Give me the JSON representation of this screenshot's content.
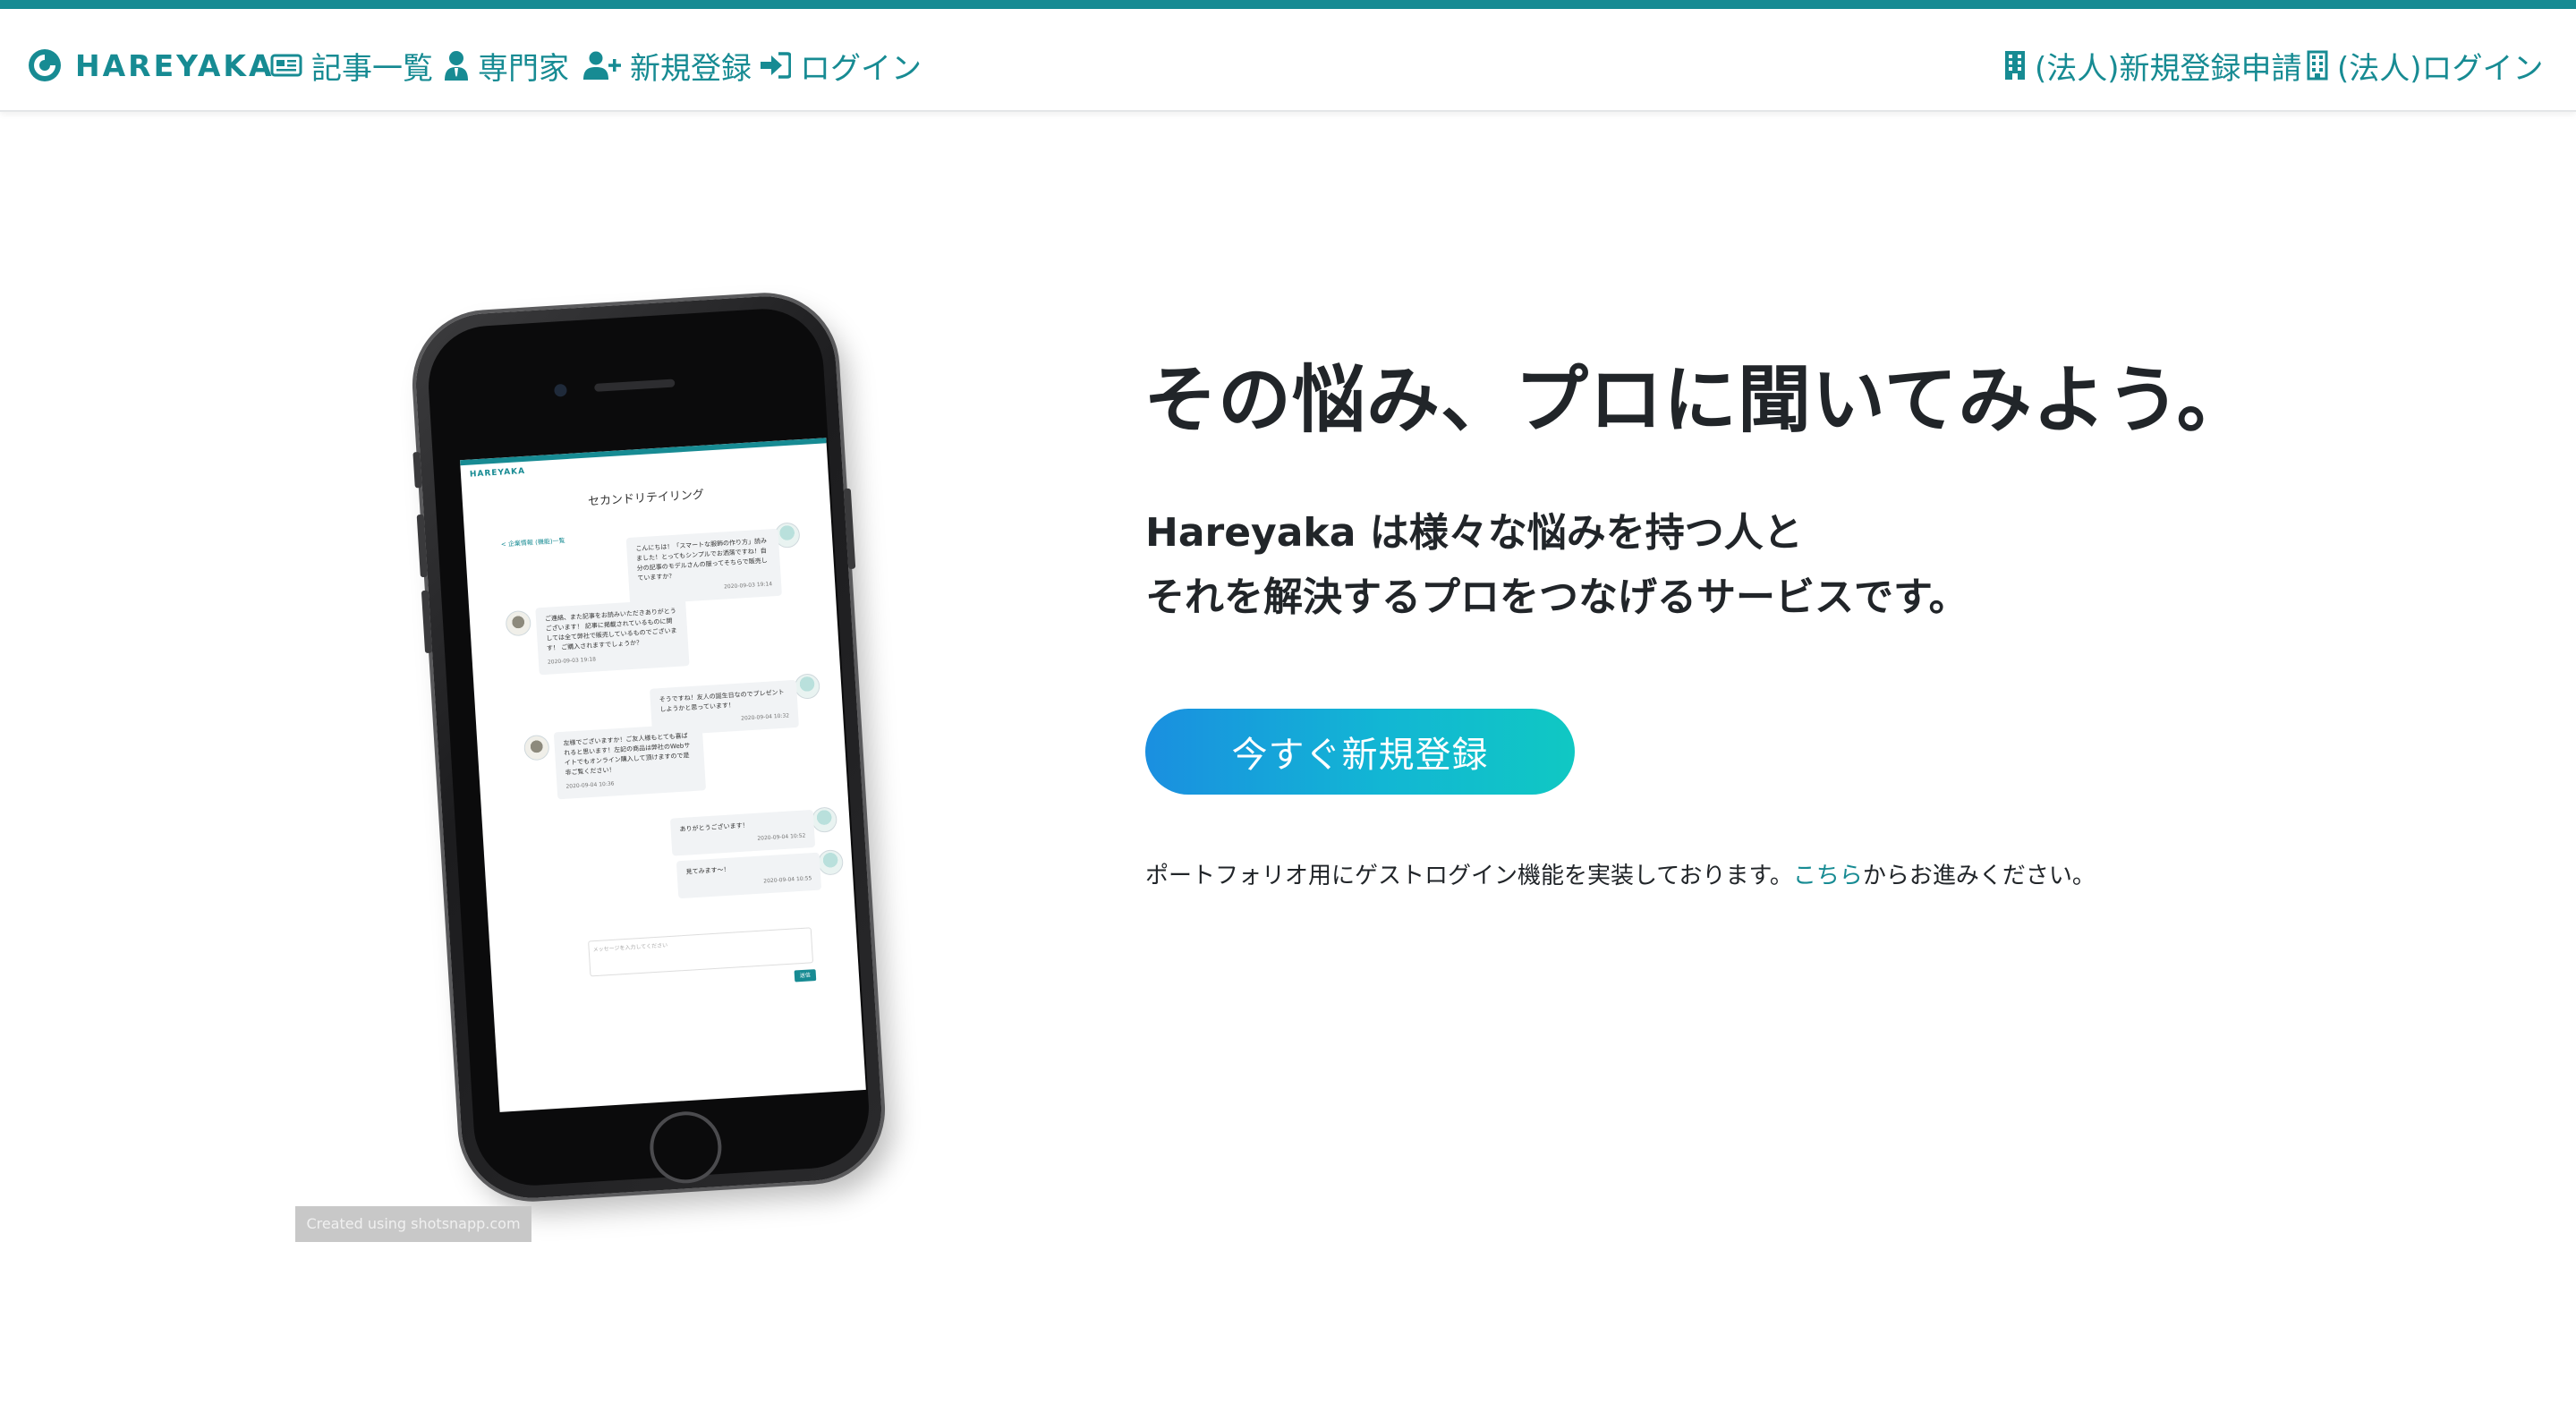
{
  "colors": {
    "brand": "#178b93",
    "cta_start": "#1a8fe0",
    "cta_end": "#10c8c3",
    "text": "#212529"
  },
  "nav": {
    "brand": "HAREYAKA",
    "articles": "記事一覧",
    "experts": "専門家",
    "signup": "新規登録",
    "login": "ログイン",
    "corp_signup": "(法人)新規登録申請",
    "corp_login": "(法人)ログイン",
    "icons": [
      "logo-icon",
      "newspaper-icon",
      "user-tie-icon",
      "user-plus-icon",
      "sign-in-icon",
      "building-icon",
      "building-icon"
    ]
  },
  "hero": {
    "headline": "その悩み、プロに聞いてみよう。",
    "lead_line1": "Hareyaka は様々な悩みを持つ人と",
    "lead_line2": "それを解決するプロをつなげるサービスです。",
    "cta": "今すぐ新規登録",
    "note_before": "ポートフォリオ用にゲストログイン機能を実装しております。",
    "note_link": "こちら",
    "note_after": "からお進みください。"
  },
  "mockup": {
    "brand": "HAREYAKA",
    "title": "セカンドリテイリング",
    "back_link": "< 企業情報 (機能)一覧",
    "messages": [
      {
        "side": "right",
        "text": "こんにちは！「スマートな服飾の作り方」読みました！とってもシンプルでお洒落ですね！自分の記事のモデルさんの服ってそちらで販売していますか？",
        "time": "2020-09-03 19:14"
      },
      {
        "side": "left",
        "text": "ご連絡、また記事をお読みいただきありがとうございます！ 記事に掲載されているものに関しては全て弊社で販売しているものでございます！ ご購入されますでしょうか？",
        "time": "2020-09-03 19:18"
      },
      {
        "side": "right",
        "text": "そうですね！友人の誕生日なのでプレゼントしようかと思っています！",
        "time": "2020-09-04 10:32"
      },
      {
        "side": "left",
        "text": "左様でございますか！ご友人様もとても喜ばれると思います！左記の商品は弊社のWebサイトでもオンライン購入して頂けますので是非ご覧ください！",
        "time": "2020-09-04 10:36"
      },
      {
        "side": "right",
        "text": "ありがとうございます！",
        "time": "2020-09-04 10:52"
      },
      {
        "side": "right",
        "text": "見てみます〜！",
        "time": "2020-09-04 10:55"
      }
    ],
    "input_placeholder": "メッセージを入力してください",
    "send": "送信"
  },
  "watermark": "Created using shotsnapp.com"
}
